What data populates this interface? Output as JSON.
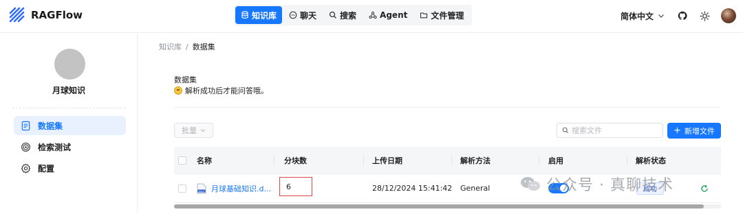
{
  "app": {
    "name": "RAGFlow"
  },
  "nav": {
    "items": [
      {
        "label": "知识库",
        "icon": "database-icon",
        "active": true
      },
      {
        "label": "聊天",
        "icon": "chat-icon",
        "active": false
      },
      {
        "label": "搜索",
        "icon": "search-icon",
        "active": false
      },
      {
        "label": "Agent",
        "icon": "agent-icon",
        "active": false
      },
      {
        "label": "文件管理",
        "icon": "folder-icon",
        "active": false
      }
    ]
  },
  "header": {
    "language": "简体中文"
  },
  "sidebar": {
    "kb_name": "月球知识",
    "items": [
      {
        "label": "数据集",
        "icon": "document-icon",
        "active": true
      },
      {
        "label": "检索测试",
        "icon": "target-icon",
        "active": false
      },
      {
        "label": "配置",
        "icon": "gear-icon",
        "active": false
      }
    ]
  },
  "breadcrumb": {
    "root": "知识库",
    "separator": "/",
    "current": "数据集"
  },
  "section": {
    "title": "数据集",
    "description": "解析成功后才能问答哦。"
  },
  "toolbar": {
    "bulk_label": "批量",
    "search_placeholder": "搜索文件",
    "new_label": "新增文件"
  },
  "table": {
    "headers": [
      "名称",
      "分块数",
      "上传日期",
      "解析方法",
      "启用",
      "解析状态"
    ],
    "rows": [
      {
        "name": "月球基础知识.d...",
        "chunks": "6",
        "upload_date": "28/12/2024 15:41:42",
        "parse_method": "General",
        "enabled": true,
        "status": "成功"
      }
    ]
  },
  "watermark": {
    "text": "公众号 · 真聊技术"
  },
  "colors": {
    "accent": "#1677ff",
    "highlight_border": "#e04444"
  }
}
